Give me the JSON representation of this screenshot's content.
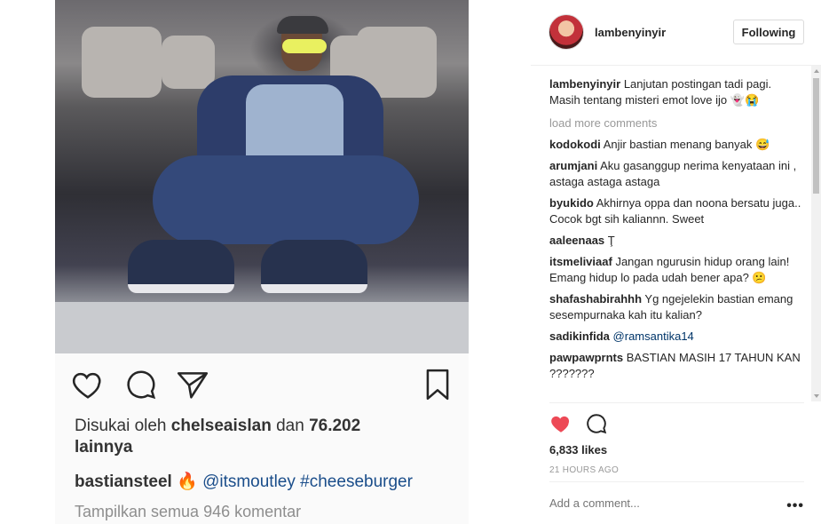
{
  "post_image": {
    "liked_by_prefix": "Disukai oleh",
    "liked_by_user": "chelseaislan",
    "liked_by_and": "dan",
    "liked_by_count": "76.202",
    "liked_by_suffix": "lainnya",
    "caption_user": "bastiansteel",
    "caption_emoji": "🔥",
    "caption_mention": "@itsmoutley",
    "caption_hashtag": "#cheeseburger",
    "view_all": "Tampilkan semua 946 komentar"
  },
  "header": {
    "username": "lambenyinyir",
    "follow_label": "Following"
  },
  "caption": {
    "user": "lambenyinyir",
    "text": "Lanjutan postingan tadi pagi. Masih tentang misteri emot love ijo 👻😭"
  },
  "load_more": "load more comments",
  "comments": [
    {
      "user": "kodokodi",
      "text": "Anjir bastian menang banyak 😅"
    },
    {
      "user": "arumjani",
      "text": "Aku gasanggup nerima kenyataan ini , astaga astaga astaga"
    },
    {
      "user": "byukido",
      "text": "Akhirnya oppa dan noona bersatu juga.. Cocok bgt sih kaliannn. Sweet"
    },
    {
      "user": "aaleenaas",
      "text": "Ţ"
    },
    {
      "user": "itsmeliviaaf",
      "text": "Jangan ngurusin hidup orang lain! Emang hidup lo pada udah bener apa? 😕"
    },
    {
      "user": "shafashabirahhh",
      "text": "Yg ngejelekin bastian emang sesempurnaka kah itu kalian?"
    },
    {
      "user": "sadikinfida",
      "text": "",
      "mention": "@ramsantika14"
    },
    {
      "user": "pawpawprnts",
      "text": "BASTIAN MASIH 17 TAHUN KAN ???????"
    }
  ],
  "likes": "6,833 likes",
  "time": "21 HOURS AGO",
  "add_comment_placeholder": "Add a comment...",
  "more_options": "•••",
  "colors": {
    "heart": "#ed4956",
    "mention": "#003569",
    "muted": "#999999"
  }
}
